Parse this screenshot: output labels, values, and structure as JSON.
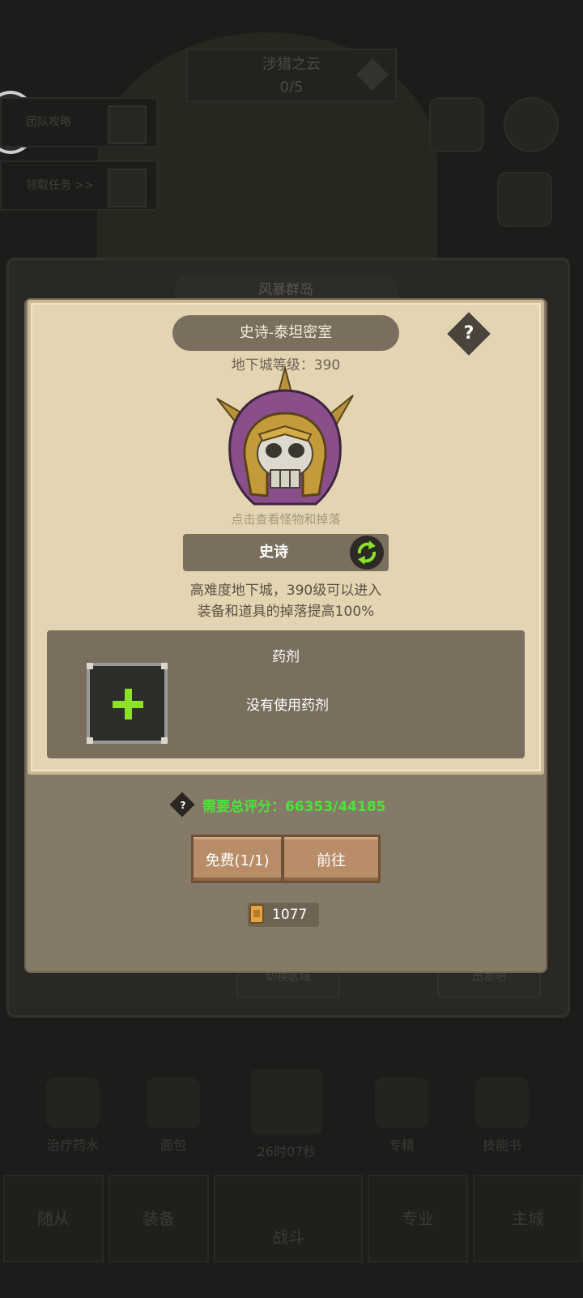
{
  "background": {
    "banner_title": "涉猎之云",
    "banner_progress": "0/5",
    "task1": "团队攻略",
    "task2": "领取任务 >>",
    "panel_title": "风暴群岛",
    "bottom_items": [
      {
        "label": "治疗药水"
      },
      {
        "label": "面包"
      },
      {
        "label": "26时07秒"
      },
      {
        "label": "专精"
      },
      {
        "label": "技能书"
      }
    ],
    "lower_buttons": [
      "切换区域",
      "出发吧"
    ],
    "nav": [
      {
        "label": "随从"
      },
      {
        "label": "装备"
      },
      {
        "label": "战斗"
      },
      {
        "label": "专业"
      },
      {
        "label": "主城"
      }
    ]
  },
  "dungeon": {
    "title": "史诗-泰坦密室",
    "help": "?",
    "level_text": "地下城等级：390",
    "hint": "点击查看怪物和掉落",
    "difficulty": "史诗",
    "desc_line1": "高难度地下城，390级可以进入",
    "desc_line2": "装备和道具的掉落提高100%"
  },
  "potion": {
    "title": "药剂",
    "empty_text": "没有使用药剂"
  },
  "requirement": {
    "help": "?",
    "text": "需要总评分：66353/44185"
  },
  "actions": {
    "free_label": "免费(1/1)",
    "go_label": "前往"
  },
  "tickets": {
    "count": "1077"
  },
  "colors": {
    "score_green": "#4ee13c",
    "plus_green": "#8be02c",
    "helmet_purple": "#8a4f8a",
    "helmet_gold": "#c49b3a"
  }
}
